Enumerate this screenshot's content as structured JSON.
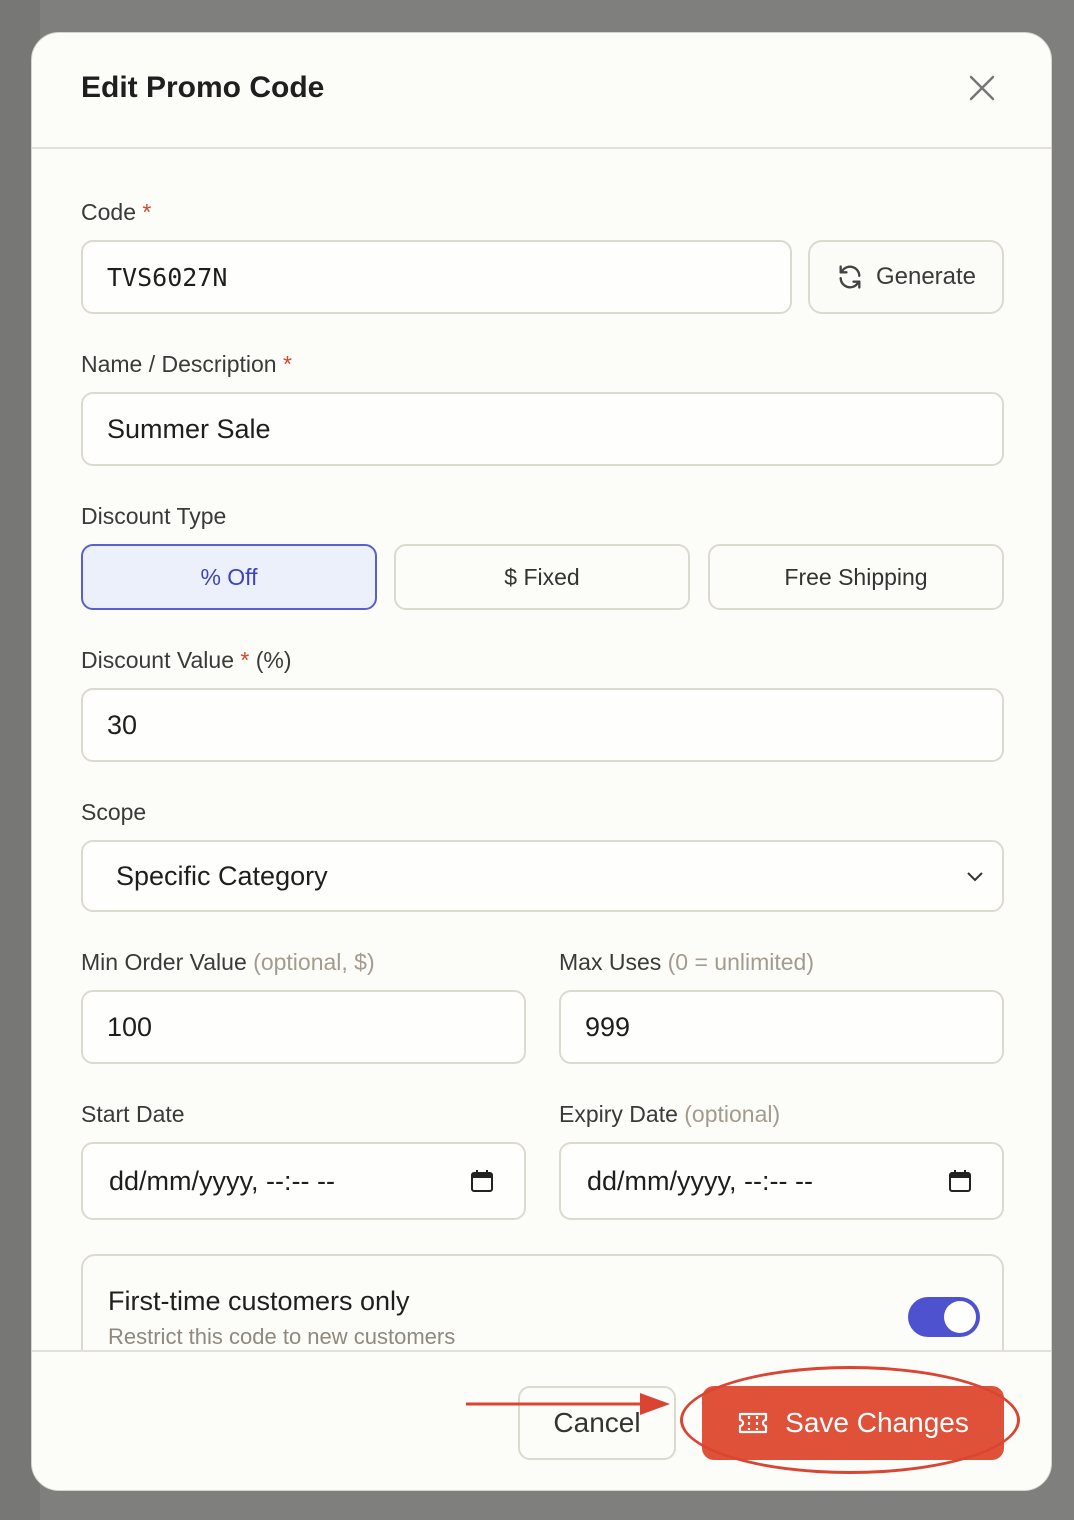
{
  "modal": {
    "title": "Edit Promo Code"
  },
  "form": {
    "code": {
      "label": "Code",
      "required_mark": "*",
      "value": "TVS6027N"
    },
    "generate_label": "Generate",
    "name": {
      "label": "Name / Description",
      "required_mark": "*",
      "value": "Summer Sale"
    },
    "discount_type": {
      "label": "Discount Type",
      "options": [
        "% Off",
        "$ Fixed",
        "Free Shipping"
      ],
      "selected": "% Off"
    },
    "discount_value": {
      "label": "Discount Value",
      "required_mark": "*",
      "unit": "(%)",
      "value": "30"
    },
    "scope": {
      "label": "Scope",
      "value": "Specific Category"
    },
    "min_order": {
      "label": "Min Order Value",
      "hint": "(optional, $)",
      "value": "100"
    },
    "max_uses": {
      "label": "Max Uses",
      "hint": "(0 = unlimited)",
      "value": "999"
    },
    "start_date": {
      "label": "Start Date",
      "placeholder": "dd/mm/yyyy, --:-- --"
    },
    "expiry_date": {
      "label": "Expiry Date",
      "hint": "(optional)",
      "placeholder": "dd/mm/yyyy, --:-- --"
    },
    "first_time": {
      "title": "First-time customers only",
      "subtitle": "Restrict this code to new customers",
      "enabled": true
    }
  },
  "footer": {
    "cancel_label": "Cancel",
    "save_label": "Save Changes"
  },
  "colors": {
    "accent": "#4f52cf",
    "save": "#e0513a",
    "annotation": "#d94532"
  }
}
